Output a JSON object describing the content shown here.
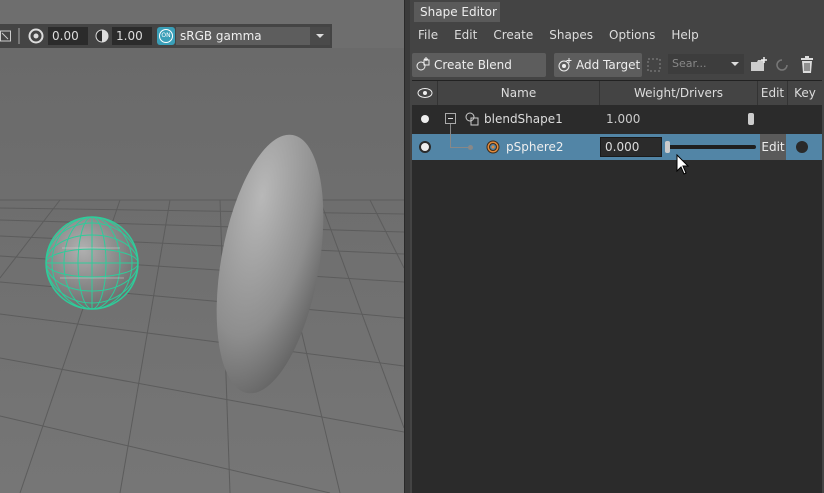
{
  "viewport": {
    "toolbar": {
      "exposure_value": "0.00",
      "gamma_value": "1.00",
      "color_management_badge": "ON",
      "color_space": "sRGB gamma"
    }
  },
  "shape_editor": {
    "title": "Shape Editor",
    "menu": [
      "File",
      "Edit",
      "Create",
      "Shapes",
      "Options",
      "Help"
    ],
    "toolbar": {
      "create_blend_shape": "Create Blend Shape",
      "add_target": "Add Target",
      "search_placeholder": "Sear..."
    },
    "columns": {
      "name": "Name",
      "weight": "Weight/Drivers",
      "edit": "Edit",
      "key": "Key"
    },
    "rows": [
      {
        "name": "blendShape1",
        "weight": "1.000",
        "selected": false
      },
      {
        "name": "pSphere2",
        "weight": "0.000",
        "edit": "Edit",
        "selected": true,
        "slider_fraction": 0.0
      }
    ]
  },
  "colors": {
    "selection": "#5285a6",
    "panel_bg": "#2b2b2b",
    "ui_bg": "#444444",
    "wireframe": "#2ecc9a"
  }
}
